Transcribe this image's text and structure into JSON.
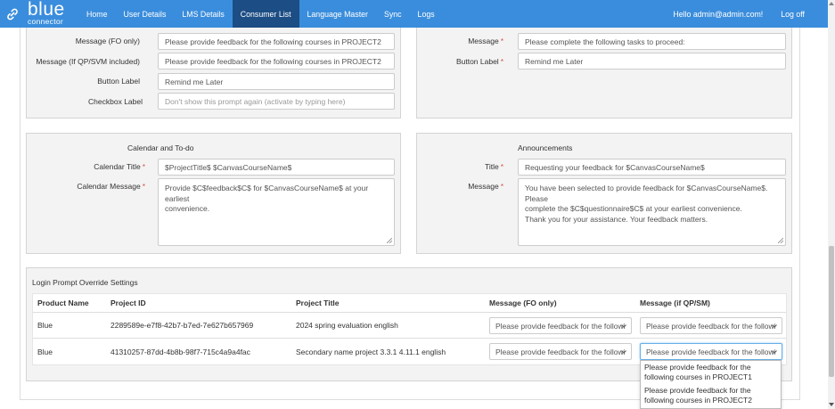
{
  "navbar": {
    "brand": "blue",
    "brand_sub": "connector",
    "items": [
      "Home",
      "User Details",
      "LMS Details",
      "Consumer List",
      "Language Master",
      "Sync",
      "Logs"
    ],
    "active_index": 3,
    "greeting": "Hello admin@admin.com!",
    "logout": "Log off",
    "bg_color": "#3a8ddc",
    "active_color": "#1c4d84"
  },
  "left_prompt": {
    "fields": [
      {
        "label": "Message (FO only)",
        "required": false,
        "value": "Please provide feedback for the following courses in PROJECT2"
      },
      {
        "label": "Message (If QP/SVM included)",
        "required": false,
        "value": "Please provide feedback for the following courses in PROJECT2"
      },
      {
        "label": "Button Label",
        "required": false,
        "value": "Remind me Later"
      },
      {
        "label": "Checkbox Label",
        "required": false,
        "placeholder": "Don't show this prompt again (activate by typing here)"
      }
    ]
  },
  "right_prompt": {
    "fields": [
      {
        "label": "Message",
        "required": true,
        "value": "Please complete the following tasks to proceed:"
      },
      {
        "label": "Button Label",
        "required": true,
        "value": "Remind me Later"
      }
    ]
  },
  "calendar": {
    "title": "Calendar and To-do",
    "title_label": "Calendar Title",
    "title_value": "$ProjectTitle$ $CanvasCourseName$",
    "message_label": "Calendar Message",
    "message_value": "Provide $C$feedback$C$ for $CanvasCourseName$ at your earliest\nconvenience."
  },
  "announcements": {
    "title": "Announcements",
    "title_label": "Title",
    "title_value": "Requesting your feedback for $CanvasCourseName$",
    "message_label": "Message",
    "message_value": "You have been selected to provide feedback for $CanvasCourseName$. Please\ncomplete the $C$questionnaire$C$ at your earliest convenience.\nThank you for your assistance. Your feedback matters."
  },
  "override": {
    "title": "Login Prompt Override Settings",
    "columns": [
      "Product Name",
      "Project ID",
      "Project Title",
      "Message (FO only)",
      "Message (if QP/SM)"
    ],
    "rows": [
      {
        "product": "Blue",
        "project_id": "2289589e-e7f8-42b7-b7ed-7e627b657969",
        "project_title": "2024 spring evaluation english",
        "msg_fo": "Please provide feedback for the followi",
        "msg_qp": "Please provide feedback for the followi"
      },
      {
        "product": "Blue",
        "project_id": "41310257-87dd-4b8b-98f7-715c4a9a4fac",
        "project_title": "Secondary name project 3.3.1 4.11.1 english",
        "msg_fo": "Please provide feedback for the followi",
        "msg_qp": "Please provide feedback for the followi"
      }
    ],
    "dropdown_options": [
      "Please provide feedback for the following courses in PROJECT1",
      "Please provide feedback for the following courses in PROJECT2"
    ]
  }
}
